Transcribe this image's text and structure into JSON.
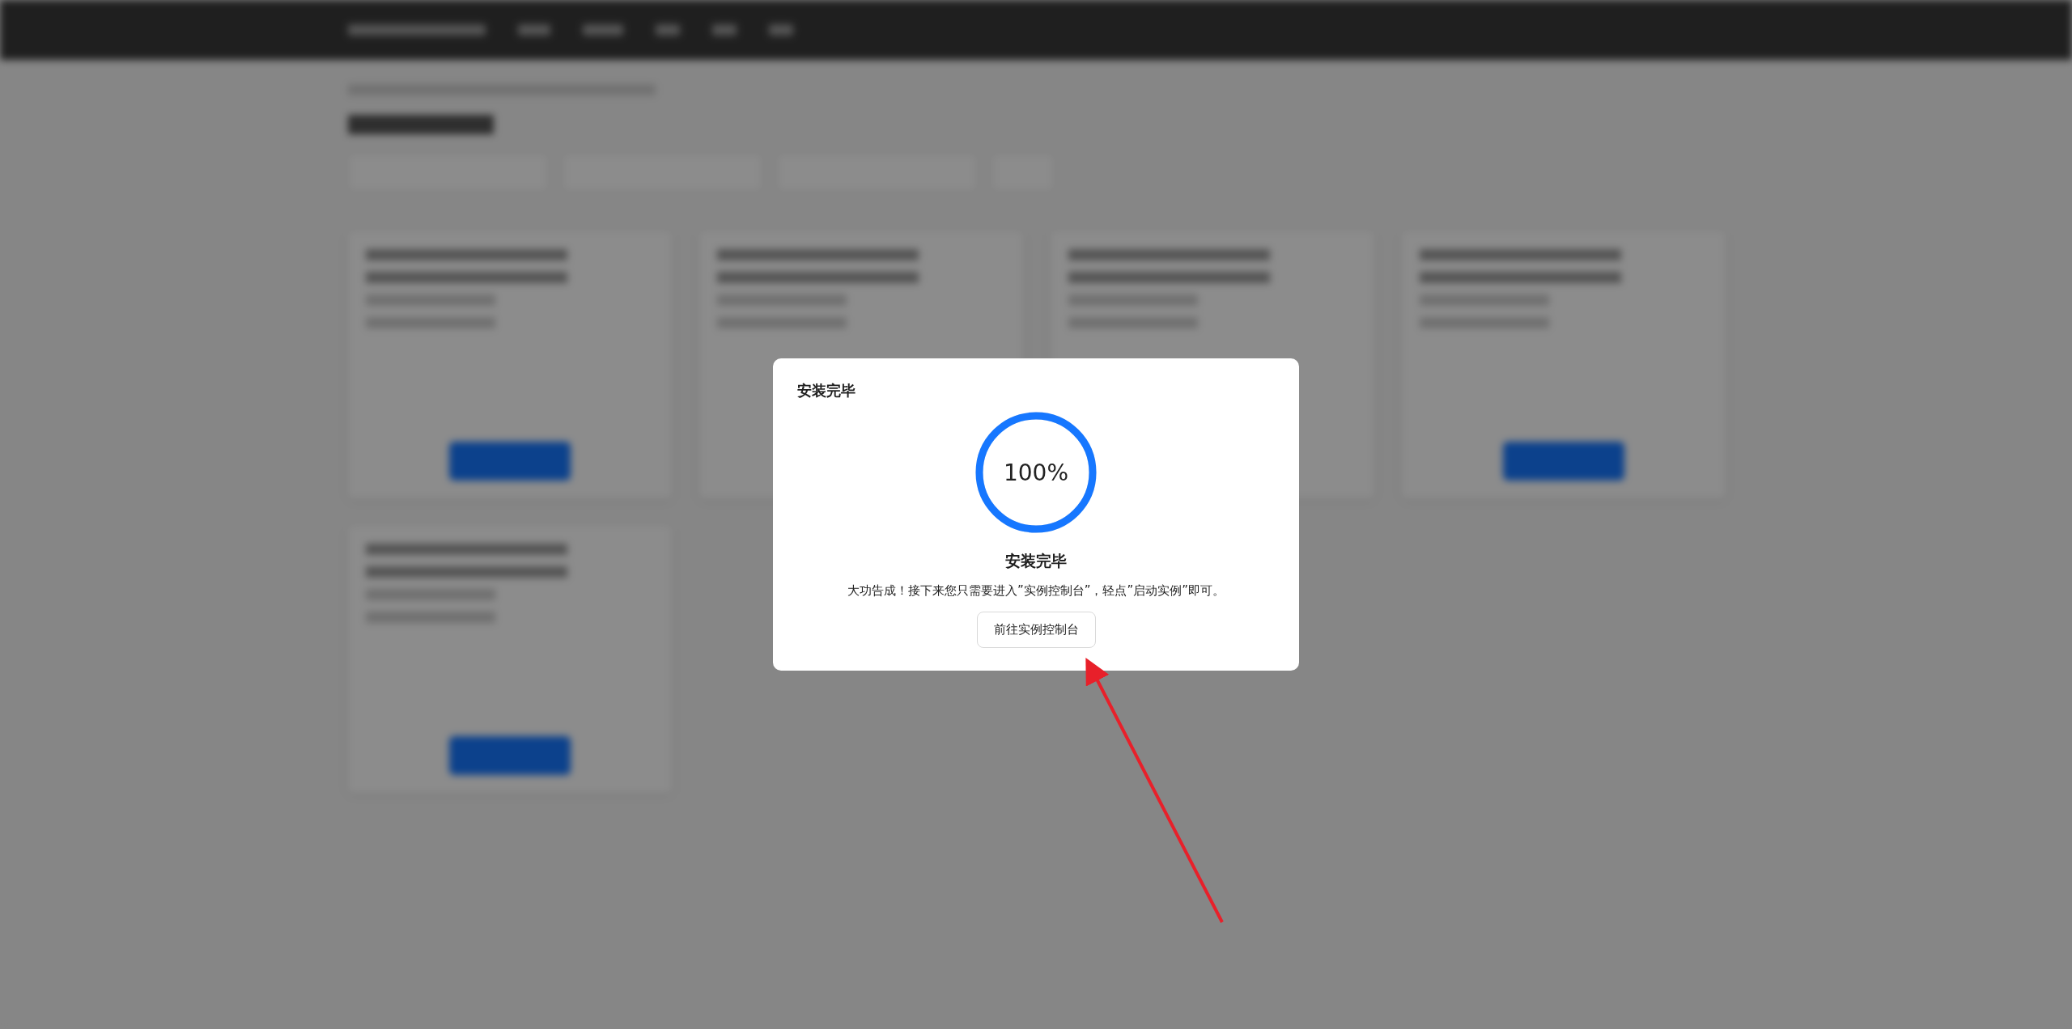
{
  "dialog": {
    "title": "安装完毕",
    "progress": {
      "level": 1,
      "label": "100%"
    },
    "result_title": "安装完毕",
    "message": "大功告成！接下来您只需要进入”实例控制台”，轻点”启动实例”即可。",
    "button": "前往实例控制台"
  }
}
